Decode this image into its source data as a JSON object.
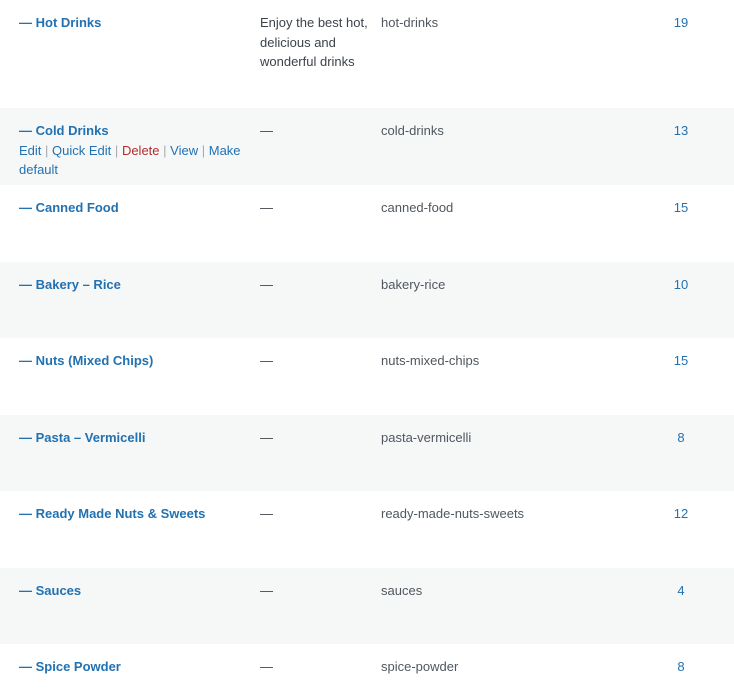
{
  "rows": [
    {
      "name": "— Hot Drinks",
      "description": "Enjoy the best hot, delicious and wonderful drinks",
      "slug": "hot-drinks",
      "count": "19"
    },
    {
      "name": "— Cold Drinks",
      "description": "—",
      "slug": "cold-drinks",
      "count": "13",
      "actions": {
        "edit": "Edit",
        "quick_edit": "Quick Edit",
        "delete": "Delete",
        "view": "View",
        "make_default": "Make default"
      }
    },
    {
      "name": "— Canned Food",
      "description": "—",
      "slug": "canned-food",
      "count": "15"
    },
    {
      "name": "— Bakery – Rice",
      "description": "—",
      "slug": "bakery-rice",
      "count": "10"
    },
    {
      "name": "— Nuts (Mixed Chips)",
      "description": "—",
      "slug": "nuts-mixed-chips",
      "count": "15"
    },
    {
      "name": "— Pasta – Vermicelli",
      "description": "—",
      "slug": "pasta-vermicelli",
      "count": "8"
    },
    {
      "name": "— Ready Made Nuts & Sweets",
      "description": "—",
      "slug": "ready-made-nuts-sweets",
      "count": "12"
    },
    {
      "name": "— Sauces",
      "description": "—",
      "slug": "sauces",
      "count": "4"
    },
    {
      "name": "— Spice Powder",
      "description": "—",
      "slug": "spice-powder",
      "count": "8"
    }
  ],
  "colors": {
    "link": "#2271b1",
    "delete": "#b32d2e",
    "alt_row": "#f6f7f7",
    "text": "#3c434a"
  }
}
